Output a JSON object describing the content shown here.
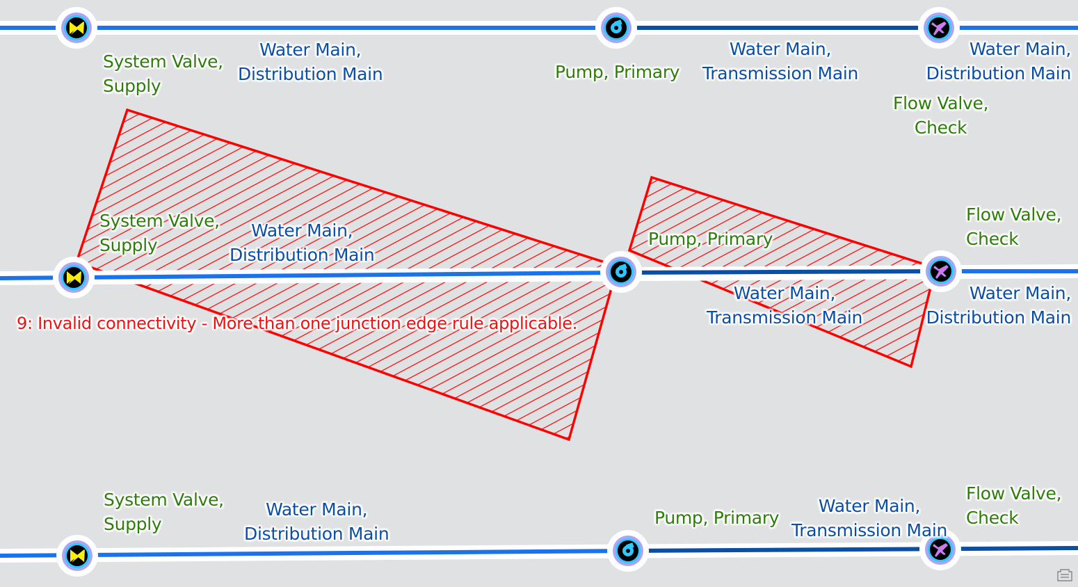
{
  "map": {
    "colors": {
      "background": "#e0e1e3",
      "distribution_main": "#1a73e8",
      "transmission_main": "#0a4ea6",
      "error": "#ff0000",
      "valve_label": "#2e7d0b",
      "main_label": "#0a4ea6"
    },
    "rows": [
      {
        "name": "top",
        "valve_label": [
          "System Valve,",
          "Supply"
        ],
        "dist_main_label": [
          "Water Main,",
          "Distribution Main"
        ],
        "pump_label": "Pump, Primary",
        "trans_main_label": [
          "Water Main,",
          "Transmission Main"
        ],
        "right_main_label": [
          "Water Main,",
          "Distribution Main"
        ],
        "check_label": [
          "Flow Valve,",
          "Check"
        ]
      },
      {
        "name": "middle",
        "valve_label": [
          "System Valve,",
          "Supply"
        ],
        "dist_main_label": [
          "Water Main,",
          "Distribution Main"
        ],
        "pump_label": "Pump, Primary",
        "trans_main_label": [
          "Water Main,",
          "Transmission Main"
        ],
        "right_main_label": [
          "Water Main,",
          "Distribution Main"
        ],
        "check_label": [
          "Flow Valve,",
          "Check"
        ],
        "error_label": "9: Invalid connectivity - More than one junction edge rule applicable."
      },
      {
        "name": "bottom",
        "valve_label": [
          "System Valve,",
          "Supply"
        ],
        "dist_main_label": [
          "Water Main,",
          "Distribution Main"
        ],
        "pump_label": "Pump, Primary",
        "trans_main_label": [
          "Water Main,",
          "Transmission Main"
        ],
        "check_label": [
          "Flow Valve,",
          "Check"
        ]
      }
    ],
    "symbols": {
      "system_valve": "system-valve-icon",
      "pump": "pump-icon",
      "check_valve": "check-valve-icon"
    },
    "status_icon": "map-tips-icon"
  }
}
